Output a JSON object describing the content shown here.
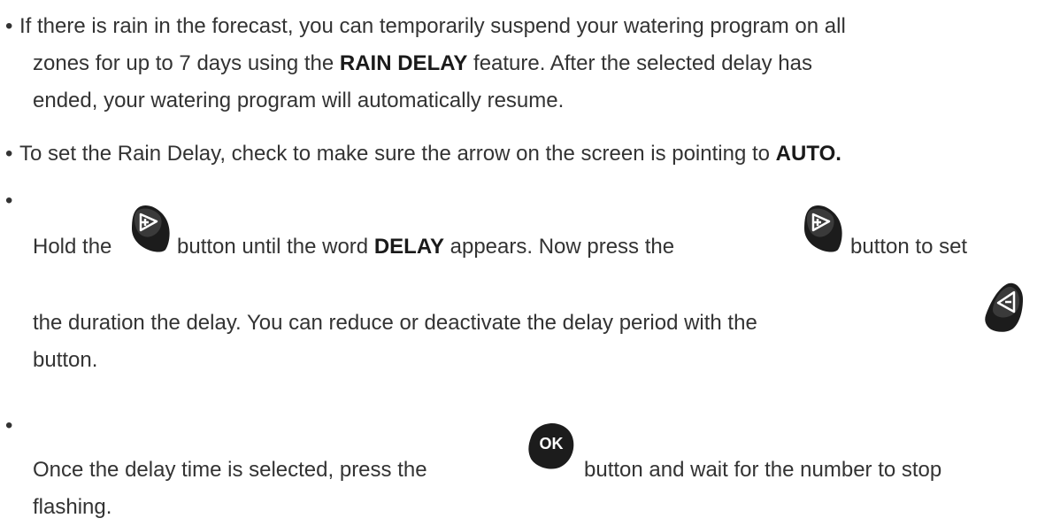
{
  "bullet": "•",
  "items": [
    {
      "t1": "If there is rain in the forecast, you can temporarily suspend your watering program on all",
      "t2a": "zones for up to 7 days using the ",
      "t2b": "RAIN DELAY",
      "t2c": " feature. After the selected delay has",
      "t3": "ended, your watering program will automatically resume."
    },
    {
      "t1a": "To set the Rain Delay, check to make sure the arrow on the screen is pointing to ",
      "t1b": "AUTO."
    },
    {
      "t1": "Hold the",
      "t2": "button until the word ",
      "t3": "DELAY",
      "t4": " appears. Now press the",
      "t5": "button to set",
      "t6": "the duration the delay. You can reduce or deactivate the delay period with the",
      "t7": "button."
    },
    {
      "t1": "Once the delay time is selected, press the",
      "t2": "button and wait for the number to stop",
      "t3": "flashing."
    }
  ],
  "icons": {
    "plus_button": "plus-button-icon",
    "minus_button": "minus-button-icon",
    "ok_button": "ok-button-icon",
    "ok_label": "OK"
  }
}
